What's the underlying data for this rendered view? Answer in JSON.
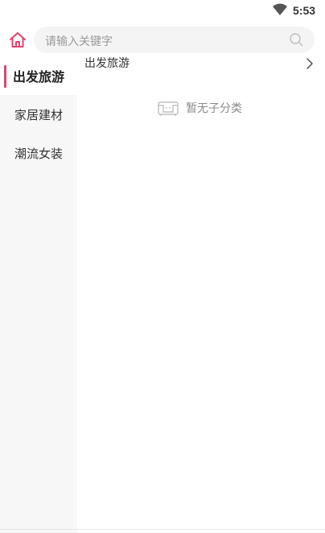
{
  "status_bar": {
    "time": "5:53",
    "wifi_icon": "wifi-icon"
  },
  "header": {
    "home_icon": "home-icon",
    "search": {
      "placeholder": "请输入关键字",
      "icon": "search-icon"
    }
  },
  "sidebar": {
    "items": [
      {
        "label": "出发旅游",
        "active": true
      },
      {
        "label": "家居建材",
        "active": false
      },
      {
        "label": "潮流女装",
        "active": false
      }
    ]
  },
  "content": {
    "category_title": "出发旅游",
    "chevron_icon": "chevron-right-icon",
    "empty_state": {
      "icon": "empty-box-icon",
      "text": "暂无子分类"
    }
  },
  "colors": {
    "accent": "#e2436f",
    "sidebar_bg": "#f7f7f7",
    "search_bg": "#f4f4f4"
  }
}
